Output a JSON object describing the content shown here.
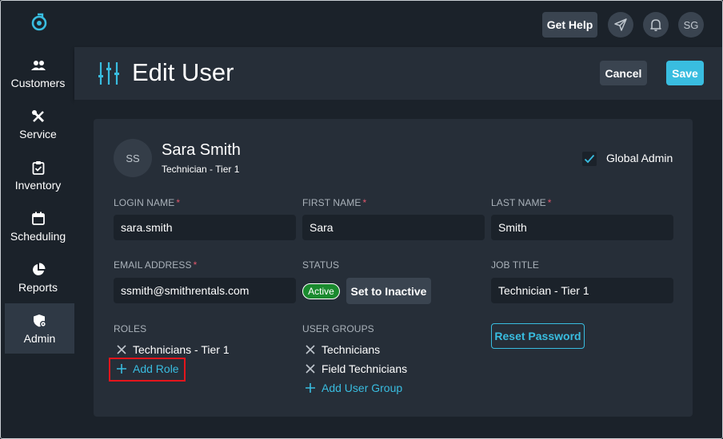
{
  "sidebar": {
    "items": [
      {
        "label": "Customers",
        "icon": "people-icon"
      },
      {
        "label": "Service",
        "icon": "tools-icon"
      },
      {
        "label": "Inventory",
        "icon": "clipboard-check-icon"
      },
      {
        "label": "Scheduling",
        "icon": "calendar-icon"
      },
      {
        "label": "Reports",
        "icon": "pie-chart-icon"
      },
      {
        "label": "Admin",
        "icon": "shield-gear-icon"
      }
    ],
    "active": "Admin"
  },
  "topbar": {
    "help_label": "Get Help",
    "avatar_initials": "SG"
  },
  "header": {
    "title": "Edit User",
    "cancel_label": "Cancel",
    "save_label": "Save"
  },
  "user": {
    "initials": "SS",
    "name": "Sara Smith",
    "subtitle": "Technician - Tier 1",
    "global_admin_label": "Global Admin",
    "global_admin_checked": true
  },
  "form": {
    "login_name": {
      "label": "LOGIN NAME",
      "required": "*",
      "value": "sara.smith"
    },
    "first_name": {
      "label": "FIRST NAME",
      "required": "*",
      "value": "Sara"
    },
    "last_name": {
      "label": "LAST NAME",
      "required": "*",
      "value": "Smith"
    },
    "email": {
      "label": "EMAIL ADDRESS",
      "required": "*",
      "value": "ssmith@smithrentals.com"
    },
    "status": {
      "label": "STATUS",
      "badge": "Active",
      "toggle_label": "Set to Inactive"
    },
    "job_title": {
      "label": "JOB TITLE",
      "value": "Technician - Tier 1"
    },
    "reset_password_label": "Reset Password",
    "roles": {
      "label": "ROLES",
      "items": [
        "Technicians - Tier 1"
      ],
      "add_label": "Add Role"
    },
    "user_groups": {
      "label": "USER GROUPS",
      "items": [
        "Technicians",
        "Field Technicians"
      ],
      "add_label": "Add User Group"
    }
  },
  "colors": {
    "accent": "#39bde0",
    "background": "#1b222a",
    "card": "#262e38",
    "active_badge": "#1a8a2e",
    "required": "#e0566b",
    "highlight": "#e4151c"
  }
}
